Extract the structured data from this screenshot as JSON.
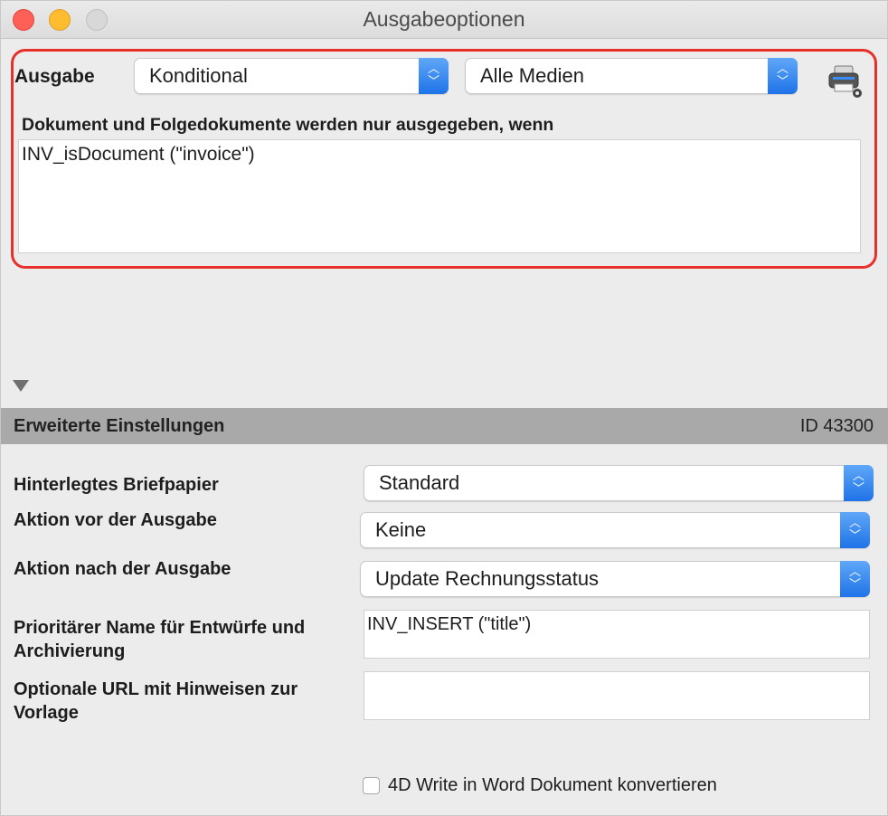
{
  "window": {
    "title": "Ausgabeoptionen"
  },
  "output": {
    "label": "Ausgabe",
    "mode_value": "Konditional",
    "media_value": "Alle Medien",
    "condition_label": "Dokument und Folgedokumente werden nur ausgegeben, wenn",
    "condition_value": "INV_isDocument (\"invoice\")"
  },
  "advanced": {
    "title": "Erweiterte Einstellungen",
    "id_text": "ID 43300",
    "letterhead_label": "Hinterlegtes Briefpapier",
    "letterhead_value": "Standard",
    "pre_action_label": "Aktion vor der Ausgabe",
    "pre_action_value": "Keine",
    "post_action_label": "Aktion nach der Ausgabe",
    "post_action_value": "Update Rechnungsstatus",
    "name_label_line1": "Prioritärer Name für Entwürfe und",
    "name_label_line2": "Archivierung",
    "name_value": "INV_INSERT (\"title\")",
    "url_label_line1": "Optionale URL mit Hinweisen zur",
    "url_label_line2": "Vorlage",
    "url_value": "",
    "convert_label": "4D Write in Word Dokument konvertieren",
    "convert_checked": false
  },
  "icons": {
    "printer": "printer-settings-icon",
    "disclosure": "disclosure-triangle-icon",
    "stepper": "popup-stepper-icon"
  },
  "colors": {
    "highlight": "#e8302a",
    "stepper_blue": "#1f73e8",
    "section_bar": "#a9a9a9"
  }
}
